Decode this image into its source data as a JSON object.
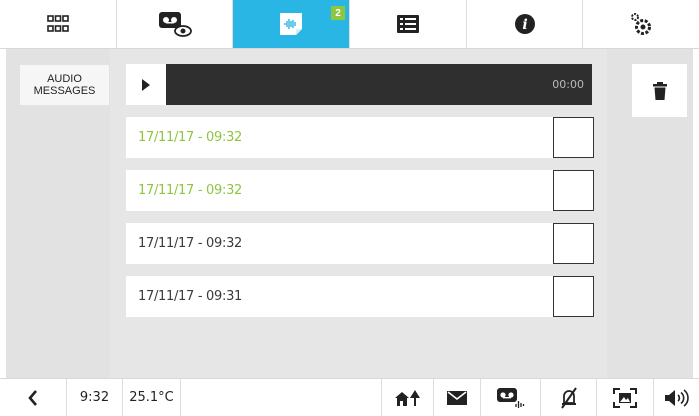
{
  "top_tabs": [
    {
      "icon": "grid-icon",
      "active": false
    },
    {
      "icon": "video-message-eye-icon",
      "active": false
    },
    {
      "icon": "audio-message-icon",
      "active": true,
      "badge": "2"
    },
    {
      "icon": "list-icon",
      "active": false
    },
    {
      "icon": "info-icon",
      "active": false
    },
    {
      "icon": "settings-gears-icon",
      "active": false
    }
  ],
  "sidebar": {
    "audio_messages_label": "AUDIO MESSAGES"
  },
  "player": {
    "time": "00:00"
  },
  "messages": [
    {
      "label": "17/11/17 - 09:32",
      "unread": true
    },
    {
      "label": "17/11/17 - 09:32",
      "unread": true
    },
    {
      "label": "17/11/17 - 09:32",
      "unread": false
    },
    {
      "label": "17/11/17 - 09:31",
      "unread": false
    }
  ],
  "statusbar": {
    "time": "9:32",
    "temperature": "25.1°C",
    "icons": [
      "home-tree-icon",
      "envelope-icon",
      "voicemail-icon",
      "mute-bell-icon",
      "scan-frame-icon",
      "speaker-icon"
    ]
  },
  "colors": {
    "accent": "#29b6e4",
    "unread": "#8dc63f",
    "player_bg": "#2f2f2f"
  }
}
